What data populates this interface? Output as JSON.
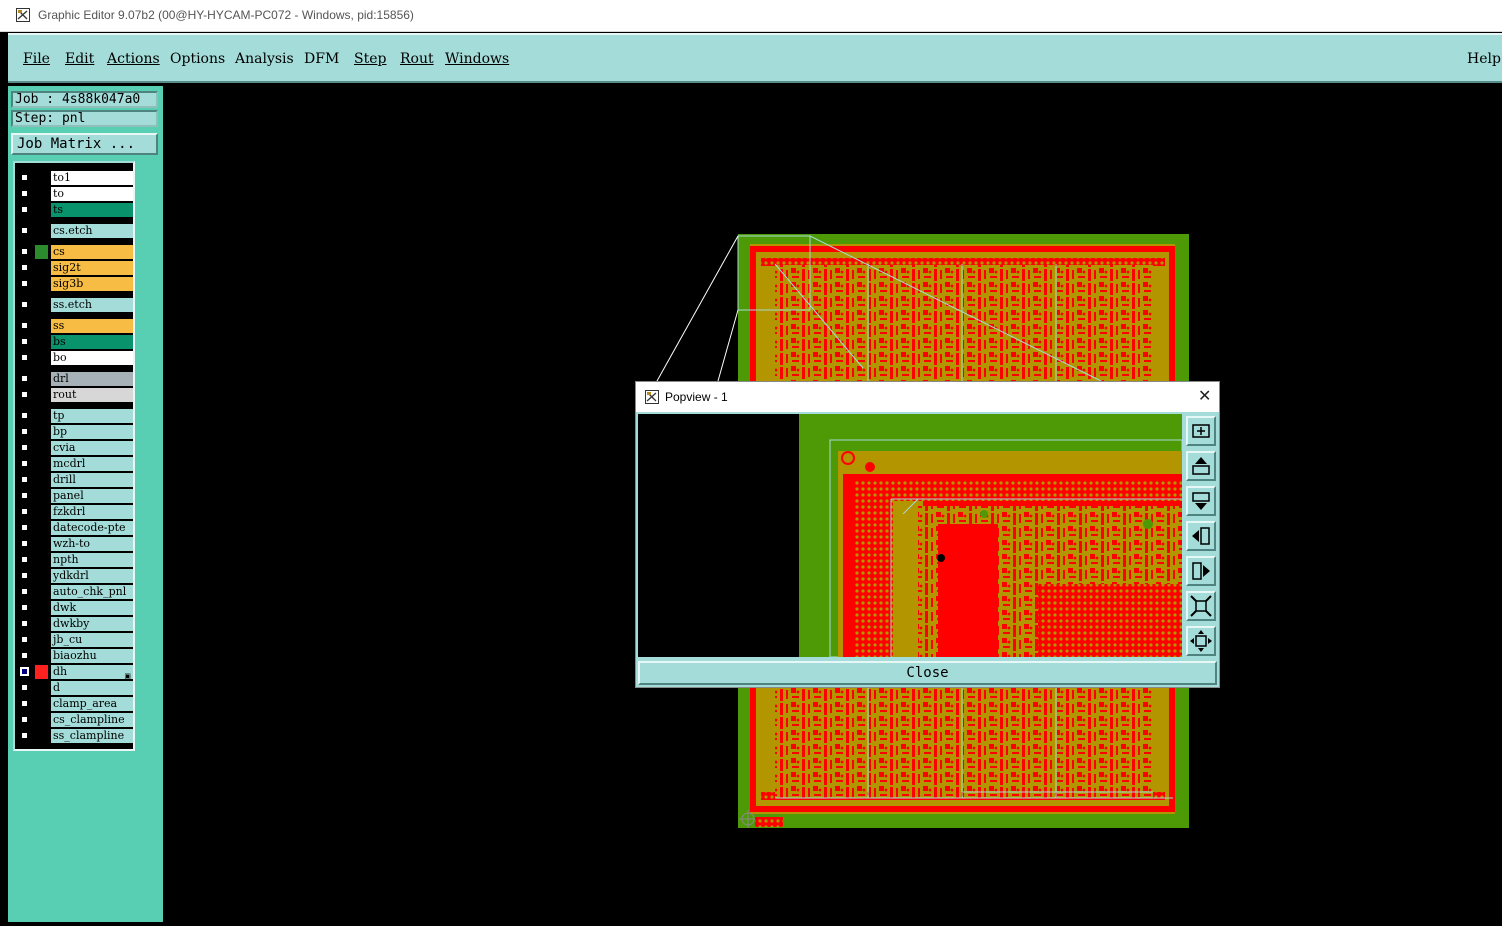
{
  "window": {
    "title": "Graphic Editor 9.07b2 (00@HY-HYCAM-PC072 - Windows, pid:15856)"
  },
  "menu": {
    "file": "File",
    "edit": "Edit",
    "actions": "Actions",
    "options": "Options",
    "analysis": "Analysis",
    "dfm": "DFM",
    "step": "Step",
    "rout": "Rout",
    "windows": "Windows",
    "help": "Help"
  },
  "job": {
    "job_line": "Job : 4s88k047a0",
    "step_line": "Step: pnl",
    "matrix_button": "Job Matrix ..."
  },
  "layers": [
    {
      "name": "to1",
      "color": "#ffffff"
    },
    {
      "name": "to",
      "color": "#ffffff"
    },
    {
      "name": "ts",
      "color": "#08936c"
    },
    {
      "name": "cs.etch",
      "color": "#a3dcd8"
    },
    {
      "name": "cs",
      "color": "#f7bc44",
      "swatch": "#2c8b2c"
    },
    {
      "name": "sig2t",
      "color": "#f7bc44"
    },
    {
      "name": "sig3b",
      "color": "#f7bc44"
    },
    {
      "name": "ss.etch",
      "color": "#a3dcd8"
    },
    {
      "name": "ss",
      "color": "#f7bc44"
    },
    {
      "name": "bs",
      "color": "#08936c"
    },
    {
      "name": "bo",
      "color": "#ffffff"
    },
    {
      "name": "drl",
      "color": "#a6b2b8"
    },
    {
      "name": "rout",
      "color": "#d7d7d7"
    },
    {
      "name": "tp",
      "color": "#a3dcd8"
    },
    {
      "name": "bp",
      "color": "#a3dcd8"
    },
    {
      "name": "cvia",
      "color": "#a3dcd8"
    },
    {
      "name": "mcdrl",
      "color": "#a3dcd8"
    },
    {
      "name": "drill",
      "color": "#a3dcd8"
    },
    {
      "name": "panel",
      "color": "#a3dcd8"
    },
    {
      "name": "fzkdrl",
      "color": "#a3dcd8"
    },
    {
      "name": "datecode-pte",
      "color": "#a3dcd8"
    },
    {
      "name": "wzh-to",
      "color": "#a3dcd8"
    },
    {
      "name": "npth",
      "color": "#a3dcd8"
    },
    {
      "name": "ydkdrl",
      "color": "#a3dcd8"
    },
    {
      "name": "auto_chk_pnl",
      "color": "#a3dcd8"
    },
    {
      "name": "dwk",
      "color": "#a3dcd8"
    },
    {
      "name": "dwkby",
      "color": "#a3dcd8"
    },
    {
      "name": "jb_cu",
      "color": "#a3dcd8"
    },
    {
      "name": "biaozhu",
      "color": "#a3dcd8"
    },
    {
      "name": "dh",
      "color": "#a3dcd8",
      "swatch": "#ff2020",
      "active": true
    },
    {
      "name": "d",
      "color": "#a3dcd8"
    },
    {
      "name": "clamp_area",
      "color": "#a3dcd8"
    },
    {
      "name": "cs_clampline",
      "color": "#a3dcd8"
    },
    {
      "name": "ss_clampline",
      "color": "#a3dcd8"
    }
  ],
  "popview": {
    "title": "Popview - 1",
    "close_label": "Close"
  },
  "colors": {
    "board_green": "#4e9a06",
    "copper": "#b39500",
    "trace_red": "#ff0000",
    "frame": "#a3dcd8"
  }
}
